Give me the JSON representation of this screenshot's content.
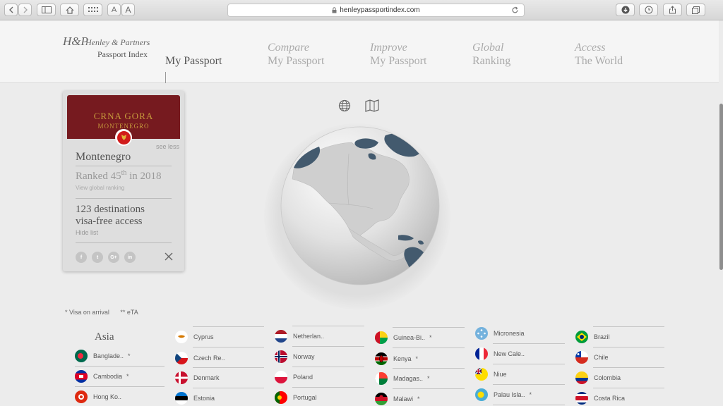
{
  "browser": {
    "url": "henleypassportindex.com",
    "text_smaller": "A",
    "text_larger": "A"
  },
  "brand": {
    "mark": "H&P",
    "name": "Henley & Partners",
    "sub": "Passport Index"
  },
  "nav": {
    "my_passport": "My Passport",
    "compare_l1": "Compare",
    "compare_l2": "My Passport",
    "improve_l1": "Improve",
    "improve_l2": "My Passport",
    "global_l1": "Global",
    "global_l2": "Ranking",
    "access_l1": "Access",
    "access_l2": "The World"
  },
  "card": {
    "cover_title": "CRNA GORA",
    "cover_sub": "MONTENEGRO",
    "see_less": "see less",
    "country": "Montenegro",
    "rank_prefix": "Ranked 45",
    "rank_suffix": "th",
    "rank_year": " in 2018",
    "rank_link": "View global ranking",
    "dest_line1": "123 destinations",
    "dest_line2": "visa-free access",
    "hide_list": "Hide list",
    "social": [
      "f",
      "t",
      "G+",
      "in"
    ]
  },
  "legend": {
    "voa": "* Visa on arrival",
    "eta": "** eTA"
  },
  "region": "Asia",
  "destinations": {
    "c1": [
      {
        "name": "Banglade..",
        "tag": "*"
      },
      {
        "name": "Cambodia",
        "tag": "*"
      },
      {
        "name": "Hong Ko..",
        "tag": ""
      }
    ],
    "c2": [
      {
        "name": "Cyprus",
        "tag": ""
      },
      {
        "name": "Czech Re..",
        "tag": ""
      },
      {
        "name": "Denmark",
        "tag": ""
      },
      {
        "name": "Estonia",
        "tag": ""
      }
    ],
    "c3": [
      {
        "name": "Netherlan..",
        "tag": ""
      },
      {
        "name": "Norway",
        "tag": ""
      },
      {
        "name": "Poland",
        "tag": ""
      },
      {
        "name": "Portugal",
        "tag": ""
      }
    ],
    "c4": [
      {
        "name": "Guinea-Bi..",
        "tag": "*"
      },
      {
        "name": "Kenya",
        "tag": "*"
      },
      {
        "name": "Madagas..",
        "tag": "*"
      },
      {
        "name": "Malawi",
        "tag": "*"
      }
    ],
    "c5": [
      {
        "name": "Micronesia",
        "tag": ""
      },
      {
        "name": "New Cale..",
        "tag": ""
      },
      {
        "name": "Niue",
        "tag": ""
      },
      {
        "name": "Palau Isla..",
        "tag": "*"
      }
    ],
    "c6": [
      {
        "name": "Brazil",
        "tag": ""
      },
      {
        "name": "Chile",
        "tag": ""
      },
      {
        "name": "Colombia",
        "tag": ""
      },
      {
        "name": "Costa Rica",
        "tag": ""
      }
    ]
  }
}
